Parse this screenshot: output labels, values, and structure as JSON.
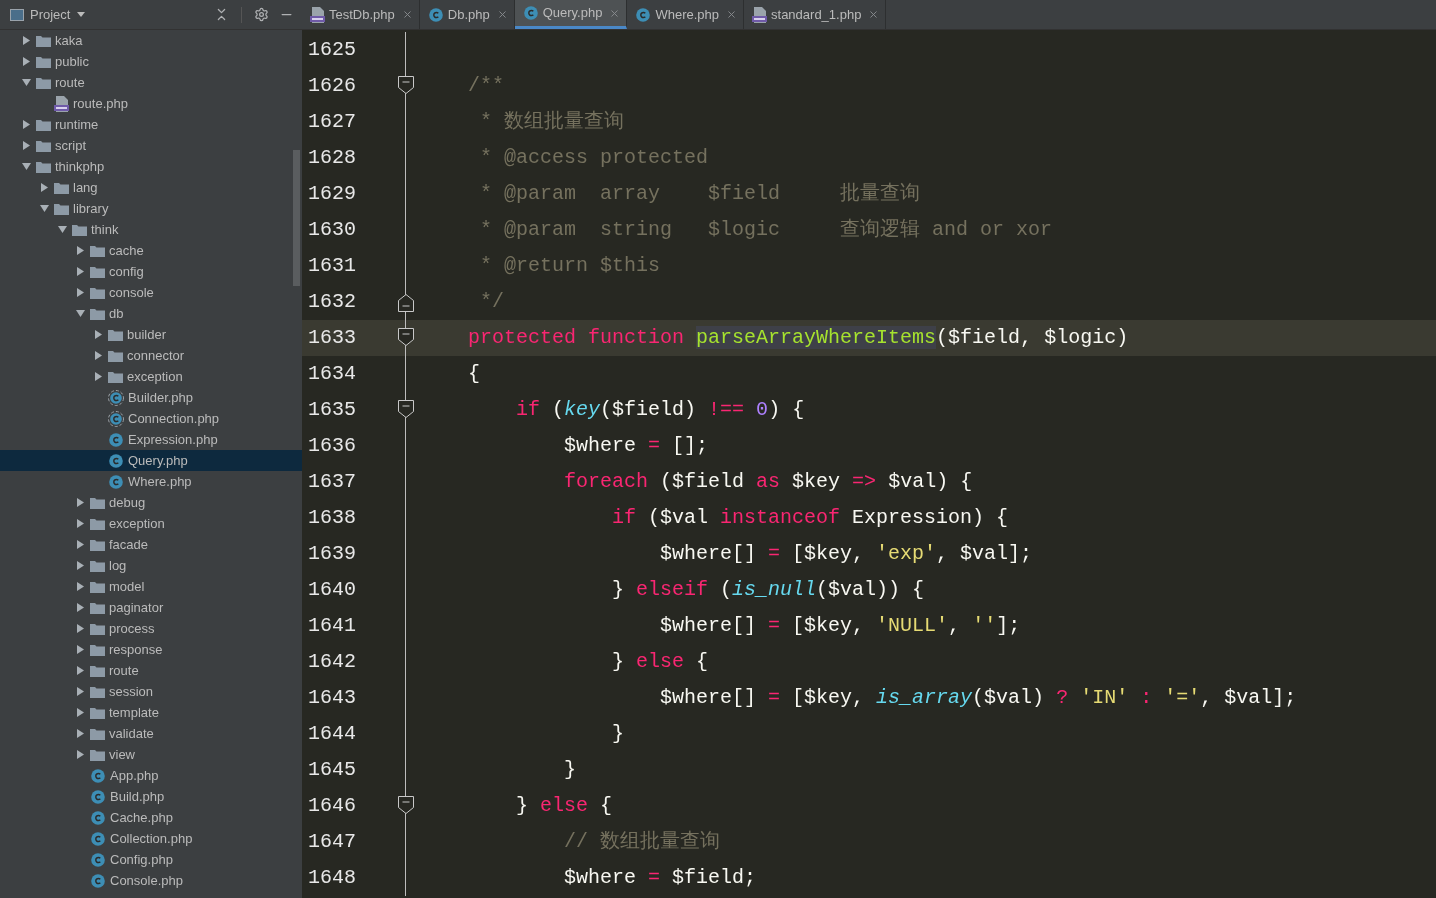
{
  "project_panel": {
    "title": "Project",
    "tree": [
      {
        "name": "kaka",
        "kind": "folder",
        "expanded": false
      },
      {
        "name": "public",
        "kind": "folder",
        "expanded": false
      },
      {
        "name": "route",
        "kind": "folder",
        "expanded": true,
        "children": [
          {
            "name": "route.php",
            "kind": "php"
          }
        ]
      },
      {
        "name": "runtime",
        "kind": "folder",
        "expanded": false
      },
      {
        "name": "script",
        "kind": "folder",
        "expanded": false
      },
      {
        "name": "thinkphp",
        "kind": "folder",
        "expanded": true,
        "children": [
          {
            "name": "lang",
            "kind": "folder",
            "expanded": false
          },
          {
            "name": "library",
            "kind": "folder",
            "expanded": true,
            "children": [
              {
                "name": "think",
                "kind": "folder",
                "expanded": true,
                "children": [
                  {
                    "name": "cache",
                    "kind": "folder",
                    "expanded": false
                  },
                  {
                    "name": "config",
                    "kind": "folder",
                    "expanded": false
                  },
                  {
                    "name": "console",
                    "kind": "folder",
                    "expanded": false
                  },
                  {
                    "name": "db",
                    "kind": "folder",
                    "expanded": true,
                    "children": [
                      {
                        "name": "builder",
                        "kind": "folder",
                        "expanded": false
                      },
                      {
                        "name": "connector",
                        "kind": "folder",
                        "expanded": false
                      },
                      {
                        "name": "exception",
                        "kind": "folder",
                        "expanded": false
                      },
                      {
                        "name": "Builder.php",
                        "kind": "abstract_class",
                        "selected": false
                      },
                      {
                        "name": "Connection.php",
                        "kind": "abstract_class",
                        "selected": false
                      },
                      {
                        "name": "Expression.php",
                        "kind": "class",
                        "selected": false
                      },
                      {
                        "name": "Query.php",
                        "kind": "class",
                        "selected": true
                      },
                      {
                        "name": "Where.php",
                        "kind": "class",
                        "selected": false
                      }
                    ]
                  },
                  {
                    "name": "debug",
                    "kind": "folder",
                    "expanded": false
                  },
                  {
                    "name": "exception",
                    "kind": "folder",
                    "expanded": false
                  },
                  {
                    "name": "facade",
                    "kind": "folder",
                    "expanded": false
                  },
                  {
                    "name": "log",
                    "kind": "folder",
                    "expanded": false
                  },
                  {
                    "name": "model",
                    "kind": "folder",
                    "expanded": false
                  },
                  {
                    "name": "paginator",
                    "kind": "folder",
                    "expanded": false
                  },
                  {
                    "name": "process",
                    "kind": "folder",
                    "expanded": false
                  },
                  {
                    "name": "response",
                    "kind": "folder",
                    "expanded": false
                  },
                  {
                    "name": "route",
                    "kind": "folder",
                    "expanded": false
                  },
                  {
                    "name": "session",
                    "kind": "folder",
                    "expanded": false
                  },
                  {
                    "name": "template",
                    "kind": "folder",
                    "expanded": false
                  },
                  {
                    "name": "validate",
                    "kind": "folder",
                    "expanded": false
                  },
                  {
                    "name": "view",
                    "kind": "folder",
                    "expanded": false
                  },
                  {
                    "name": "App.php",
                    "kind": "class",
                    "selected": false
                  },
                  {
                    "name": "Build.php",
                    "kind": "class",
                    "selected": false
                  },
                  {
                    "name": "Cache.php",
                    "kind": "class",
                    "selected": false
                  },
                  {
                    "name": "Collection.php",
                    "kind": "class",
                    "selected": false
                  },
                  {
                    "name": "Config.php",
                    "kind": "class",
                    "selected": false
                  },
                  {
                    "name": "Console.php",
                    "kind": "class",
                    "selected": false
                  }
                ]
              }
            ]
          }
        ]
      }
    ]
  },
  "tabs": [
    {
      "label": "TestDb.php",
      "kind": "php",
      "selected": false
    },
    {
      "label": "Db.php",
      "kind": "class",
      "selected": false
    },
    {
      "label": "Query.php",
      "kind": "class",
      "selected": true
    },
    {
      "label": "Where.php",
      "kind": "class",
      "selected": false
    },
    {
      "label": "standard_1.php",
      "kind": "php",
      "selected": false
    }
  ],
  "editor": {
    "lines": [
      {
        "number": "1625",
        "current": false,
        "fold_start": false,
        "fold_end": false
      },
      {
        "number": "1626",
        "current": false,
        "fold_start": true,
        "fold_end": false,
        "tokens": [
          {
            "kind": "comment",
            "text": "    /**"
          }
        ]
      },
      {
        "number": "1627",
        "current": false,
        "fold_start": false,
        "fold_end": false,
        "tokens": [
          {
            "kind": "comment",
            "text": "     * 数组批量查询"
          }
        ]
      },
      {
        "number": "1628",
        "current": false,
        "fold_start": false,
        "fold_end": false,
        "tokens": [
          {
            "kind": "comment",
            "text": "     * @access protected"
          }
        ]
      },
      {
        "number": "1629",
        "current": false,
        "fold_start": false,
        "fold_end": false,
        "tokens": [
          {
            "kind": "comment",
            "text": "     * @param  array    $field     批量查询"
          }
        ]
      },
      {
        "number": "1630",
        "current": false,
        "fold_start": false,
        "fold_end": false,
        "tokens": [
          {
            "kind": "comment",
            "text": "     * @param  string   $logic     查询逻辑 and or xor"
          }
        ]
      },
      {
        "number": "1631",
        "current": false,
        "fold_start": false,
        "fold_end": false,
        "tokens": [
          {
            "kind": "comment",
            "text": "     * @return $this"
          }
        ]
      },
      {
        "number": "1632",
        "current": false,
        "fold_start": false,
        "fold_end": true,
        "tokens": [
          {
            "kind": "comment",
            "text": "     */"
          }
        ]
      },
      {
        "number": "1633",
        "current": true,
        "fold_start": true,
        "fold_end": false,
        "tokens": [
          {
            "kind": "keyword",
            "text": "    protected function"
          },
          {
            "kind": "match",
            "text": " parseArrayWhereItems"
          },
          {
            "kind": "plain",
            "text": "($field, $logic)"
          }
        ]
      },
      {
        "number": "1634",
        "current": false,
        "fold_start": false,
        "fold_end": false,
        "tokens": [
          {
            "kind": "plain",
            "text": "    {"
          }
        ]
      },
      {
        "number": "1635",
        "current": false,
        "fold_start": true,
        "fold_end": false,
        "tokens": [
          {
            "kind": "keyword",
            "text": "        if"
          },
          {
            "kind": "plain",
            "text": " ("
          },
          {
            "kind": "builtin",
            "text": "key"
          },
          {
            "kind": "plain",
            "text": "($field) "
          },
          {
            "kind": "keyword",
            "text": "!=="
          },
          {
            "kind": "number",
            "text": " 0"
          },
          {
            "kind": "plain",
            "text": ") {"
          }
        ]
      },
      {
        "number": "1636",
        "current": false,
        "fold_start": false,
        "fold_end": false,
        "tokens": [
          {
            "kind": "plain",
            "text": "            $where "
          },
          {
            "kind": "keyword",
            "text": "="
          },
          {
            "kind": "plain",
            "text": " [];"
          }
        ]
      },
      {
        "number": "1637",
        "current": false,
        "fold_start": false,
        "fold_end": false,
        "tokens": [
          {
            "kind": "keyword",
            "text": "            foreach"
          },
          {
            "kind": "plain",
            "text": " ($field "
          },
          {
            "kind": "keyword",
            "text": "as"
          },
          {
            "kind": "plain",
            "text": " $key "
          },
          {
            "kind": "keyword",
            "text": "=>"
          },
          {
            "kind": "plain",
            "text": " $val) {"
          }
        ]
      },
      {
        "number": "1638",
        "current": false,
        "fold_start": false,
        "fold_end": false,
        "tokens": [
          {
            "kind": "keyword",
            "text": "                if"
          },
          {
            "kind": "plain",
            "text": " ($val "
          },
          {
            "kind": "keyword",
            "text": "instanceof"
          },
          {
            "kind": "plain",
            "text": " Expression) {"
          }
        ]
      },
      {
        "number": "1639",
        "current": false,
        "fold_start": false,
        "fold_end": false,
        "tokens": [
          {
            "kind": "plain",
            "text": "                    $where[] "
          },
          {
            "kind": "keyword",
            "text": "="
          },
          {
            "kind": "plain",
            "text": " [$key, "
          },
          {
            "kind": "string",
            "text": "'exp'"
          },
          {
            "kind": "plain",
            "text": ", $val];"
          }
        ]
      },
      {
        "number": "1640",
        "current": false,
        "fold_start": false,
        "fold_end": false,
        "tokens": [
          {
            "kind": "plain",
            "text": "                } "
          },
          {
            "kind": "keyword",
            "text": "elseif"
          },
          {
            "kind": "plain",
            "text": " ("
          },
          {
            "kind": "builtin",
            "text": "is_null"
          },
          {
            "kind": "plain",
            "text": "($val)) {"
          }
        ]
      },
      {
        "number": "1641",
        "current": false,
        "fold_start": false,
        "fold_end": false,
        "tokens": [
          {
            "kind": "plain",
            "text": "                    $where[] "
          },
          {
            "kind": "keyword",
            "text": "="
          },
          {
            "kind": "plain",
            "text": " [$key, "
          },
          {
            "kind": "string",
            "text": "'NULL'"
          },
          {
            "kind": "plain",
            "text": ", "
          },
          {
            "kind": "string",
            "text": "''"
          },
          {
            "kind": "plain",
            "text": "];"
          }
        ]
      },
      {
        "number": "1642",
        "current": false,
        "fold_start": false,
        "fold_end": false,
        "tokens": [
          {
            "kind": "plain",
            "text": "                } "
          },
          {
            "kind": "keyword",
            "text": "else"
          },
          {
            "kind": "plain",
            "text": " {"
          }
        ]
      },
      {
        "number": "1643",
        "current": false,
        "fold_start": false,
        "fold_end": false,
        "tokens": [
          {
            "kind": "plain",
            "text": "                    $where[] "
          },
          {
            "kind": "keyword",
            "text": "="
          },
          {
            "kind": "plain",
            "text": " [$key, "
          },
          {
            "kind": "builtin",
            "text": "is_array"
          },
          {
            "kind": "plain",
            "text": "($val) "
          },
          {
            "kind": "keyword",
            "text": "?"
          },
          {
            "kind": "string",
            "text": " 'IN'"
          },
          {
            "kind": "keyword",
            "text": " :"
          },
          {
            "kind": "string",
            "text": " '='"
          },
          {
            "kind": "plain",
            "text": ", $val];"
          }
        ]
      },
      {
        "number": "1644",
        "current": false,
        "fold_start": false,
        "fold_end": false,
        "tokens": [
          {
            "kind": "plain",
            "text": "                }"
          }
        ]
      },
      {
        "number": "1645",
        "current": false,
        "fold_start": false,
        "fold_end": false,
        "tokens": [
          {
            "kind": "plain",
            "text": "            }"
          }
        ]
      },
      {
        "number": "1646",
        "current": false,
        "fold_start": true,
        "fold_end": false,
        "tokens": [
          {
            "kind": "plain",
            "text": "        } "
          },
          {
            "kind": "keyword",
            "text": "else"
          },
          {
            "kind": "plain",
            "text": " {"
          }
        ]
      },
      {
        "number": "1647",
        "current": false,
        "fold_start": false,
        "fold_end": false,
        "tokens": [
          {
            "kind": "comment",
            "text": "            // 数组批量查询"
          }
        ]
      },
      {
        "number": "1648",
        "current": false,
        "fold_start": false,
        "fold_end": false,
        "tokens": [
          {
            "kind": "plain",
            "text": "            $where "
          },
          {
            "kind": "keyword",
            "text": "="
          },
          {
            "kind": "plain",
            "text": " $field;"
          }
        ]
      }
    ]
  }
}
